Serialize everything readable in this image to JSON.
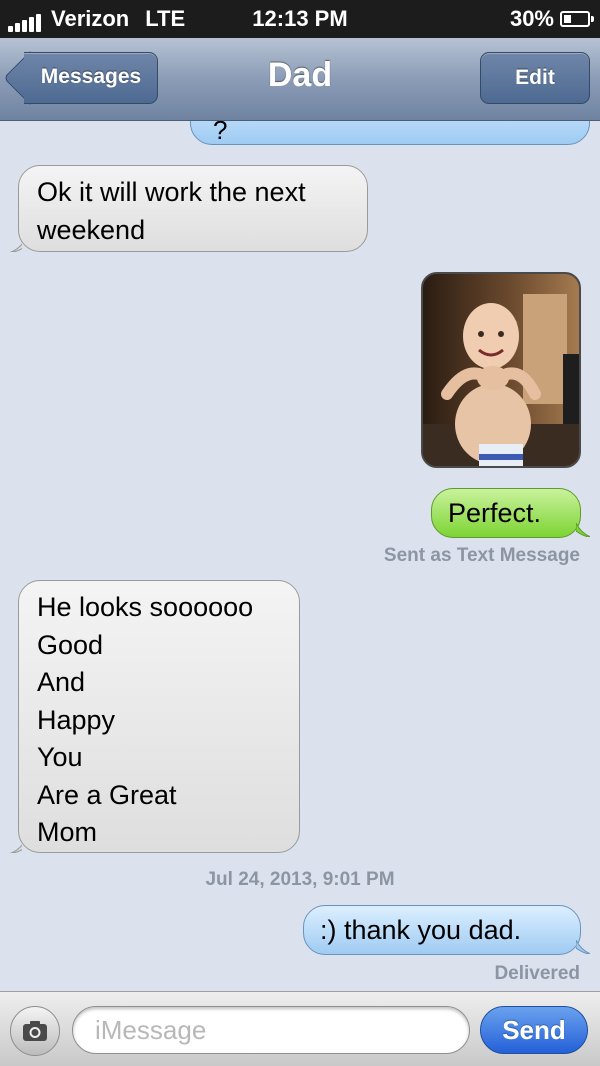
{
  "status_bar": {
    "carrier": "Verizon",
    "network": "LTE",
    "time": "12:13 PM",
    "battery_text": "30%",
    "battery_level": 0.3
  },
  "nav": {
    "back_label": "Messages",
    "title": "Dad",
    "edit_label": "Edit"
  },
  "thread": {
    "partial_top_message": "?",
    "messages": [
      {
        "direction": "received",
        "text": "Ok it will work the next weekend"
      },
      {
        "direction": "sent",
        "type": "photo"
      },
      {
        "direction": "sent",
        "type": "text_message",
        "text": "Perfect."
      },
      {
        "direction": "received",
        "lines": [
          "He looks soooooo",
          "Good",
          "And",
          "Happy",
          "You",
          "Are a Great",
          "Mom"
        ]
      },
      {
        "direction": "sent",
        "type": "imessage",
        "text": ":) thank you dad."
      }
    ],
    "sent_as_text_note": "Sent as Text Message",
    "timestamp": "Jul 24, 2013, 9:01 PM",
    "delivered_note": "Delivered"
  },
  "input_bar": {
    "placeholder": "iMessage",
    "send_label": "Send"
  },
  "colors": {
    "background": "#dbe2ed",
    "imessage_blue": "#9fcbf3",
    "sms_green": "#7dd433",
    "received_gray": "#dedede",
    "send_button": "#2460d8"
  },
  "icons": [
    "signal-icon",
    "battery-icon",
    "back-arrow-icon",
    "camera-icon"
  ]
}
